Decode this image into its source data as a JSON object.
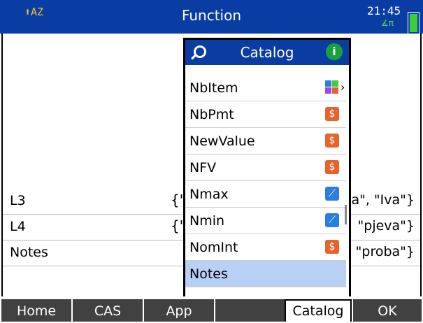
{
  "title_bar": {
    "shift_indicator": "⬆AZ",
    "title": "Function",
    "time": "21:45",
    "angle_mode": "∡π",
    "battery_color": "#3ccf3c"
  },
  "rows": [
    {
      "name": "L3",
      "prefix": "{\"",
      "value": "a\", \"Iva\"}"
    },
    {
      "name": "L4",
      "prefix": "{\"",
      "value": "\"pjeva\"}"
    },
    {
      "name": "Notes",
      "prefix": "",
      "value": "\"proba\"}"
    }
  ],
  "catalog": {
    "title": "Catalog",
    "info_icon": "i",
    "items": [
      {
        "label": "NbItem",
        "icon": "apps-icon"
      },
      {
        "label": "NbPmt",
        "icon": "finance-icon"
      },
      {
        "label": "NewValue",
        "icon": "finance-icon"
      },
      {
        "label": "NFV",
        "icon": "finance-icon"
      },
      {
        "label": "Nmax",
        "icon": "statistics-icon"
      },
      {
        "label": "Nmin",
        "icon": "statistics-icon"
      },
      {
        "label": "NomInt",
        "icon": "finance-icon"
      },
      {
        "label": "Notes",
        "icon": ""
      }
    ],
    "selected_label": "Notes",
    "accent": "#0a3da3",
    "selection_color": "#b8d0f4"
  },
  "softkeys": [
    "Home",
    "CAS",
    "App",
    "",
    "Catalog",
    "OK"
  ]
}
